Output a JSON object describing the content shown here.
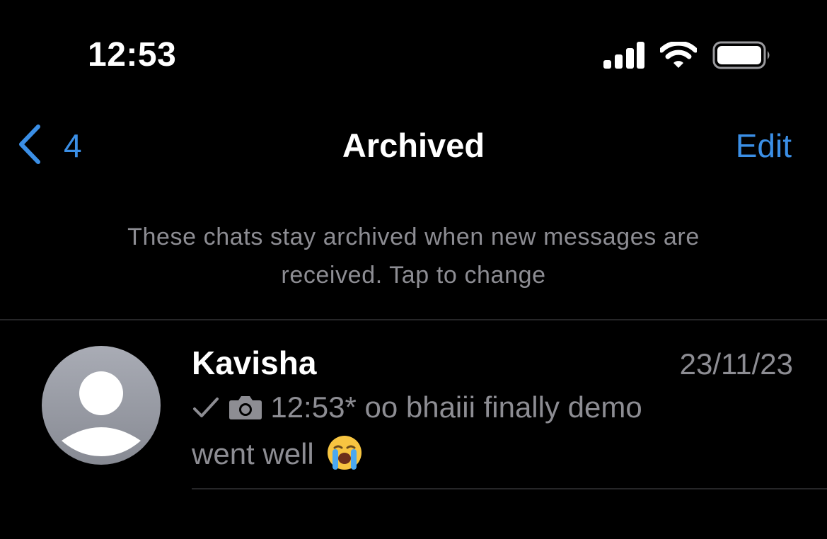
{
  "status_bar": {
    "time": "12:53",
    "signal_icon": "cellular-signal-icon",
    "wifi_icon": "wifi-icon",
    "battery_icon": "battery-icon"
  },
  "nav": {
    "back_icon": "chevron-left-icon",
    "back_count": "4",
    "title": "Archived",
    "edit_label": "Edit"
  },
  "info": {
    "line1": "These chats stay archived when new messages are",
    "line2": "received. Tap to change"
  },
  "chats": [
    {
      "name": "Kavisha",
      "date": "23/11/23",
      "avatar_icon": "default-avatar-icon",
      "status_icon": "single-check-icon",
      "media_icon": "camera-icon",
      "preview_line1": "12:53* oo bhaiii finally demo",
      "preview_line2": "went well",
      "emoji": "loudly-crying-face-emoji"
    }
  ],
  "colors": {
    "background": "#000000",
    "accent": "#3b8fe6",
    "secondary_text": "#8d8d93",
    "separator": "#262628"
  }
}
